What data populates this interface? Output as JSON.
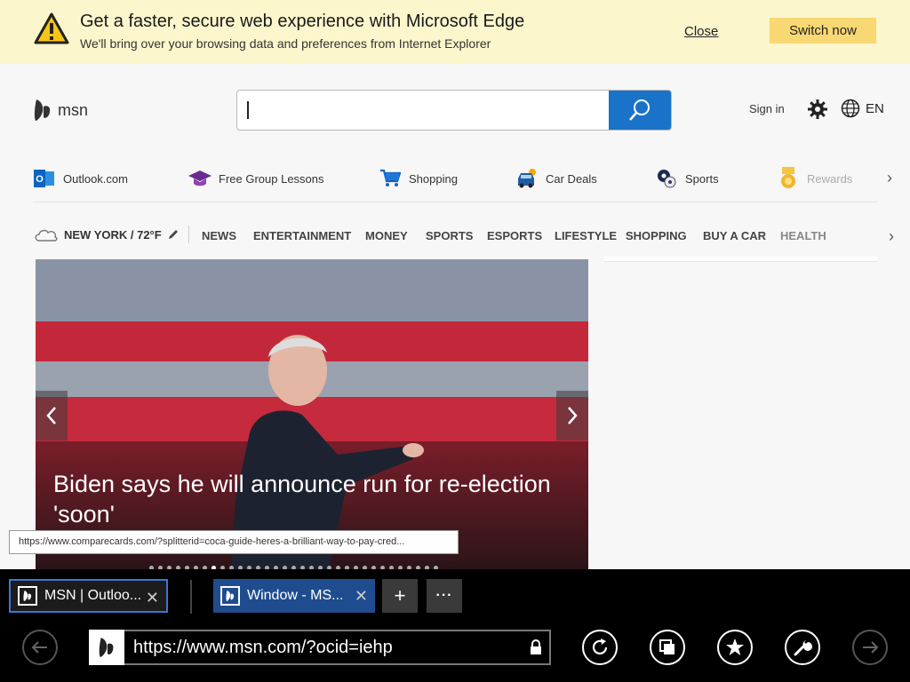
{
  "banner": {
    "title": "Get a faster, secure web experience with Microsoft Edge",
    "subtitle": "We'll bring over your browsing data and preferences from Internet Explorer",
    "close_label": "Close",
    "switch_label": "Switch now",
    "accent": "#f8d872"
  },
  "header": {
    "logo_text": "msn",
    "search_placeholder": "",
    "signin_label": "Sign in",
    "lang_label": "EN",
    "accent": "#1a73c8"
  },
  "quicklinks": [
    {
      "label": "Outlook.com",
      "icon": "outlook-icon"
    },
    {
      "label": "Free Group Lessons",
      "icon": "graduation-cap-icon"
    },
    {
      "label": "Shopping",
      "icon": "shopping-cart-icon"
    },
    {
      "label": "Car Deals",
      "icon": "car-icon"
    },
    {
      "label": "Sports",
      "icon": "sports-ball-icon"
    },
    {
      "label": "Rewards",
      "icon": "medal-icon"
    }
  ],
  "nav": {
    "weather": "NEW YORK / 72°F",
    "links": [
      "NEWS",
      "ENTERTAINMENT",
      "MONEY",
      "SPORTS",
      "ESPORTS",
      "LIFESTYLE",
      "SHOPPING",
      "BUY A CAR",
      "HEALTH"
    ]
  },
  "hero": {
    "caption": "Biden says he will announce run for re-election 'soon'"
  },
  "status_tooltip": "https://www.comparecards.com/?splitterid=coca-guide-heres-a-brilliant-way-to-pay-cred...",
  "browser": {
    "tabs": [
      {
        "title": "MSN | Outloo...",
        "active": true
      },
      {
        "title": "Window - MS...",
        "active": false
      }
    ],
    "new_tab_label": "+",
    "more_label": "···",
    "address": "https://www.msn.com/?ocid=iehp"
  }
}
